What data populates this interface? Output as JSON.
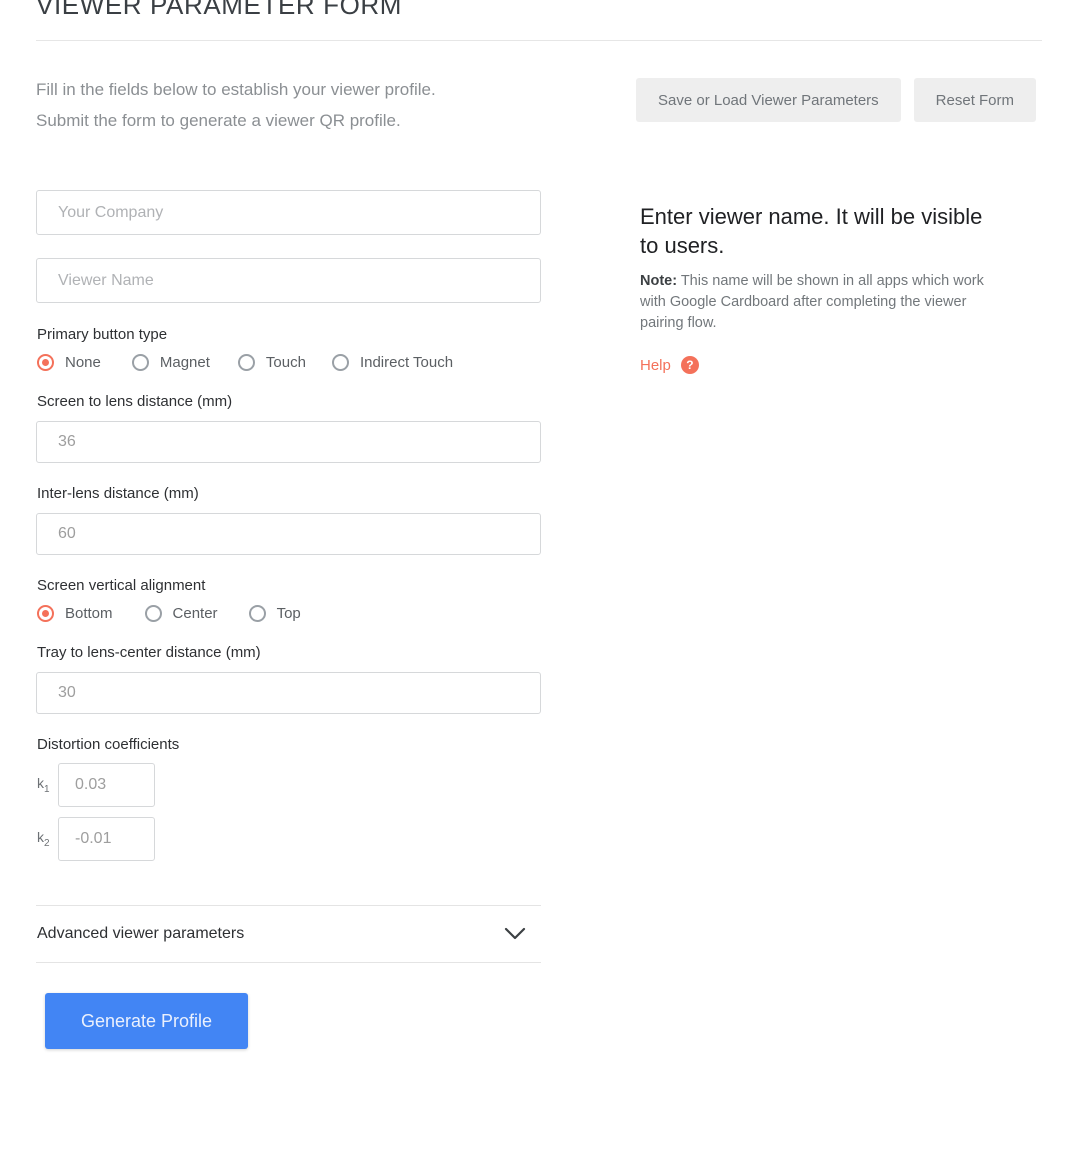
{
  "header": {
    "title": "VIEWER PARAMETER FORM"
  },
  "intro": {
    "line1": "Fill in the fields below to establish your viewer profile.",
    "line2": "Submit the form to generate a viewer QR profile."
  },
  "toolbar": {
    "save_load_label": "Save or Load Viewer Parameters",
    "reset_label": "Reset Form"
  },
  "info": {
    "heading": "Enter viewer name. It will be visible to users.",
    "note_label": "Note:",
    "note_text": " This name will be shown in all apps which work with Google Cardboard after completing the viewer pairing flow.",
    "help_label": "Help",
    "help_badge": "?"
  },
  "form": {
    "company": {
      "placeholder": "Your Company",
      "value": ""
    },
    "viewer_name": {
      "placeholder": "Viewer Name",
      "value": ""
    },
    "primary_button": {
      "label": "Primary button type",
      "selected": "None",
      "options": [
        {
          "label": "None",
          "checked": true
        },
        {
          "label": "Magnet",
          "checked": false
        },
        {
          "label": "Touch",
          "checked": false
        },
        {
          "label": "Indirect Touch",
          "checked": false
        }
      ]
    },
    "screen_to_lens": {
      "label": "Screen to lens distance (mm)",
      "placeholder": "36",
      "value": ""
    },
    "inter_lens": {
      "label": "Inter-lens distance (mm)",
      "placeholder": "60",
      "value": ""
    },
    "vertical_alignment": {
      "label": "Screen vertical alignment",
      "selected": "Bottom",
      "options": [
        {
          "label": "Bottom",
          "checked": true
        },
        {
          "label": "Center",
          "checked": false
        },
        {
          "label": "Top",
          "checked": false
        }
      ]
    },
    "tray_to_lens_center": {
      "label": "Tray to lens-center distance (mm)",
      "placeholder": "30",
      "value": ""
    },
    "distortion": {
      "label": "Distortion coefficients",
      "k1_label": "k",
      "k1_sub": "1",
      "k1_placeholder": "0.03",
      "k1_value": "",
      "k2_label": "k",
      "k2_sub": "2",
      "k2_placeholder": "-0.01",
      "k2_value": ""
    },
    "advanced": {
      "label": "Advanced viewer parameters",
      "icon": "chevron-down-icon",
      "expanded": false
    },
    "submit": {
      "label": "Generate Profile"
    }
  },
  "colors": {
    "accent": "#f4715a",
    "primary": "#4285f4",
    "button_gray": "#eeeeee",
    "border": "#d6d8da",
    "text_muted": "#8b8f93"
  }
}
